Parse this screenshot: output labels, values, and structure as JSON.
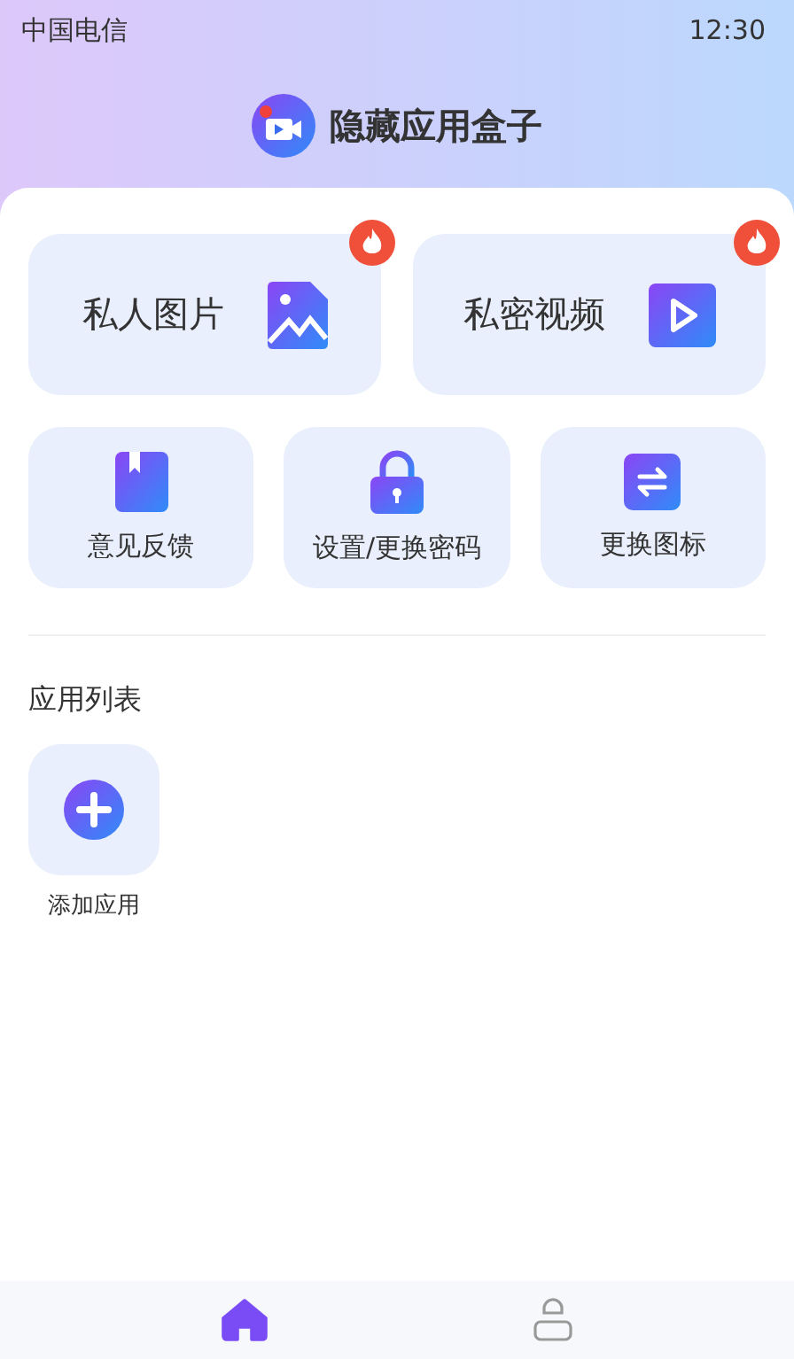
{
  "status_bar": {
    "carrier": "中国电信",
    "time": "12:30"
  },
  "header": {
    "title": "隐藏应用盒子"
  },
  "big_cards": [
    {
      "label": "私人图片",
      "kind": "image",
      "hot": true
    },
    {
      "label": "私密视频",
      "kind": "video",
      "hot": true
    }
  ],
  "small_cards": [
    {
      "label": "意见反馈",
      "kind": "book"
    },
    {
      "label": "设置/更换密码",
      "kind": "lock"
    },
    {
      "label": "更换图标",
      "kind": "swap"
    }
  ],
  "app_list": {
    "title": "应用列表",
    "items": [
      {
        "label": "添加应用",
        "kind": "add"
      }
    ]
  },
  "bottom_nav": [
    {
      "kind": "home",
      "selected": true
    },
    {
      "kind": "profile",
      "selected": false
    }
  ]
}
